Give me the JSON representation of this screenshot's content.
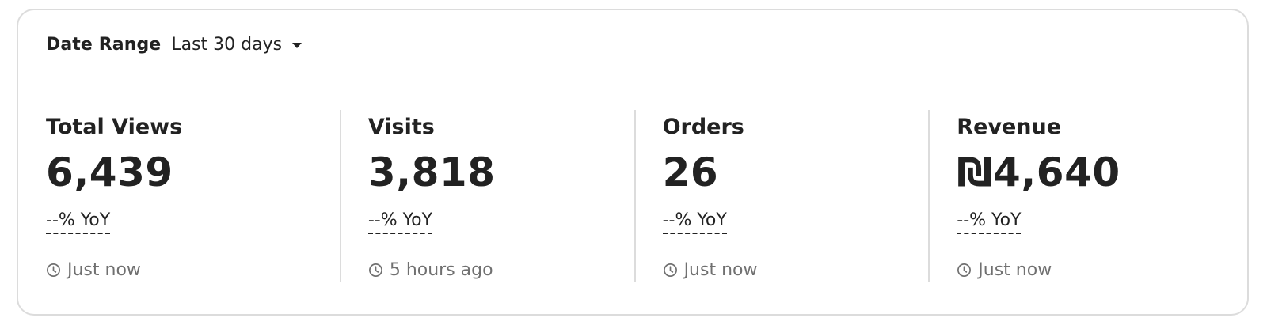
{
  "date_range": {
    "label": "Date Range",
    "value": "Last 30 days",
    "caret_icon": "caret-down-icon"
  },
  "metrics": [
    {
      "title": "Total Views",
      "value": "6,439",
      "yoy": "--% YoY",
      "updated": "Just now",
      "updated_icon": "clock-icon"
    },
    {
      "title": "Visits",
      "value": "3,818",
      "yoy": "--% YoY",
      "updated": "5 hours ago",
      "updated_icon": "clock-icon"
    },
    {
      "title": "Orders",
      "value": "26",
      "yoy": "--% YoY",
      "updated": "Just now",
      "updated_icon": "clock-icon"
    },
    {
      "title": "Revenue",
      "value": "₪4,640",
      "yoy": "--% YoY",
      "updated": "Just now",
      "updated_icon": "clock-icon"
    }
  ],
  "colors": {
    "text": "#222222",
    "muted": "#707070",
    "border": "#dcdcdc",
    "background": "#ffffff"
  }
}
